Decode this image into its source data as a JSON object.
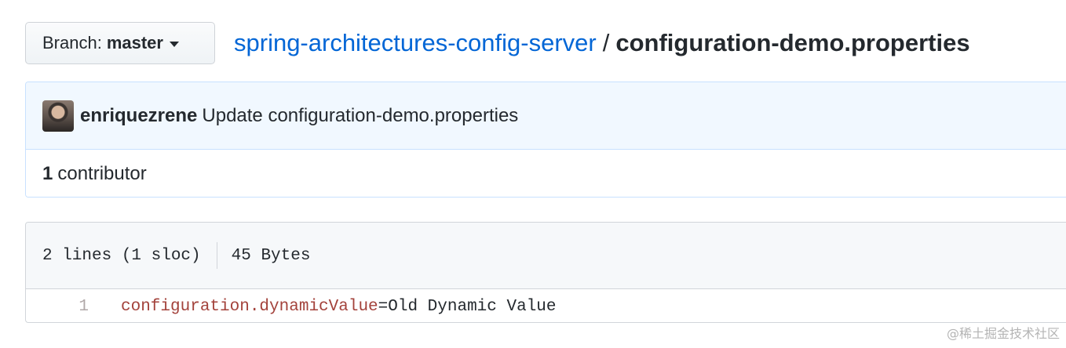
{
  "branch": {
    "prefix": "Branch:",
    "name": "master"
  },
  "breadcrumb": {
    "repo": "spring-architectures-config-server",
    "separator": "/",
    "file": "configuration-demo.properties"
  },
  "commit": {
    "author": "enriquezrene",
    "message": "Update configuration-demo.properties"
  },
  "contributors": {
    "count": "1",
    "label": "contributor"
  },
  "file_info": {
    "lines": "2 lines (1 sloc)",
    "size": "45 Bytes"
  },
  "code": {
    "lines": [
      {
        "number": "1",
        "key": "configuration.dynamicValue",
        "operator": "=",
        "value": "Old Dynamic Value"
      }
    ]
  },
  "watermark": "@稀土掘金技术社区",
  "colors": {
    "link": "#0366d6",
    "commit_bg": "#f1f8ff",
    "commit_border": "#c8e1ff",
    "code_key": "#a3423b"
  },
  "icons": {
    "branch_dropdown": "caret-down-icon",
    "author_avatar": "avatar"
  }
}
